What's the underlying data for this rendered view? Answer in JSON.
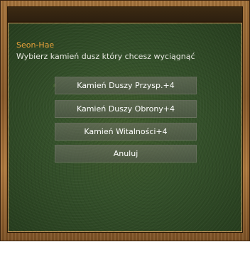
{
  "dialog": {
    "speaker": "Seon-Hae",
    "question": "Wybierz kamień dusz który chcesz wyciągnąć",
    "options": [
      "Kamień Duszy Przysp.+4",
      "Kamień Duszy Obrony+4",
      "Kamień Witalności+4",
      "Anuluj"
    ]
  },
  "colors": {
    "speaker": "#e8a13a",
    "text": "#e6e6e0",
    "frame": "#9a6a34",
    "background": "#34502a"
  }
}
